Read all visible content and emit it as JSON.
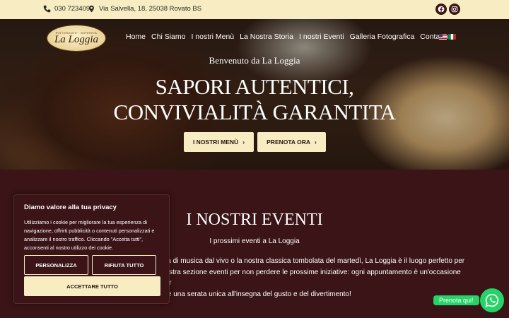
{
  "topbar": {
    "phone": "030 723409",
    "address": "Via Salvella, 18, 25038 Rovato BS",
    "social": [
      "facebook-icon",
      "instagram-icon"
    ]
  },
  "logo": {
    "small": "RISTORANTE · BIRRERIA",
    "name": "La Loggia"
  },
  "nav": [
    "Home",
    "Chi Siamo",
    "I nostri Menù",
    "La Nostra Storia",
    "I nostri Eventi",
    "Galleria Fotografica",
    "Contatto"
  ],
  "hero": {
    "welcome": "Benvenuto da La Loggia",
    "headline_1": "SAPORI AUTENTICI,",
    "headline_2": "CONVIVIALITÀ GARANTITA",
    "btn_menu": "I NOSTRI MENÙ",
    "btn_book": "PRENOTA ORA"
  },
  "events": {
    "title": "I NOSTRI EVENTI",
    "subtitle": "I prossimi eventi a La Loggia",
    "line1": "ata di musica dal vivo o la nostra classica tombolata del martedì, La Loggia è il luogo perfetto per",
    "line2": "nostra sezione eventi per non perdere le prossime iniziative: ogni appuntamento è un'occasione per",
    "line3": "ere una serata unica all'insegna del gusto e del divertimento!"
  },
  "cookie": {
    "title": "Diamo valore alla tua privacy",
    "text": "Utilizziamo i cookie per migliorare la tua esperienza di navigazione, offrirti pubblicità o contenuti personalizzati e analizzare il nostro traffico. Cliccando \"Accetta tutti\", acconsenti al nostro utilizzo dei cookie.",
    "btn_custom": "PERSONALIZZA",
    "btn_reject": "RIFIUTA TUTTO",
    "btn_accept": "ACCETTARE TUTTO"
  },
  "whatsapp": {
    "label": "Prenota qui!"
  },
  "colors": {
    "cream": "#f7ecc2",
    "maroon": "#3a1416",
    "whatsapp": "#25d366"
  }
}
